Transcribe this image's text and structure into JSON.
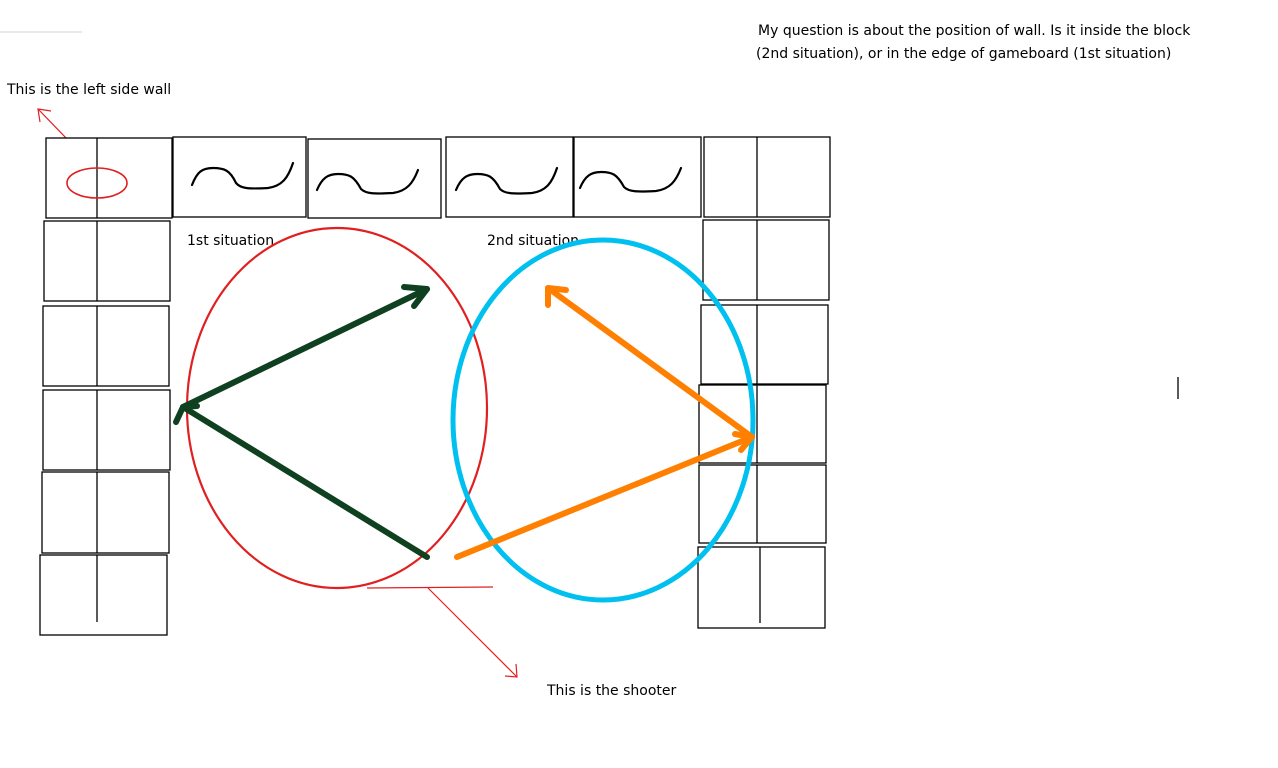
{
  "question": {
    "line1": "My question is about the position of wall. Is it inside the block",
    "line2": "(2nd situation), or in the edge of gameboard (1st situation)"
  },
  "annotations": {
    "left_wall": "This is the left side wall",
    "shooter": "This is the shooter",
    "situation1": "1st situation",
    "situation2": "2nd situation"
  },
  "colors": {
    "red_annotation": "#e02020",
    "situation1_circle": "#e02020",
    "situation2_circle": "#00c0f0",
    "situation1_arrow": "#0f4020",
    "situation2_arrow": "#ff8000"
  }
}
